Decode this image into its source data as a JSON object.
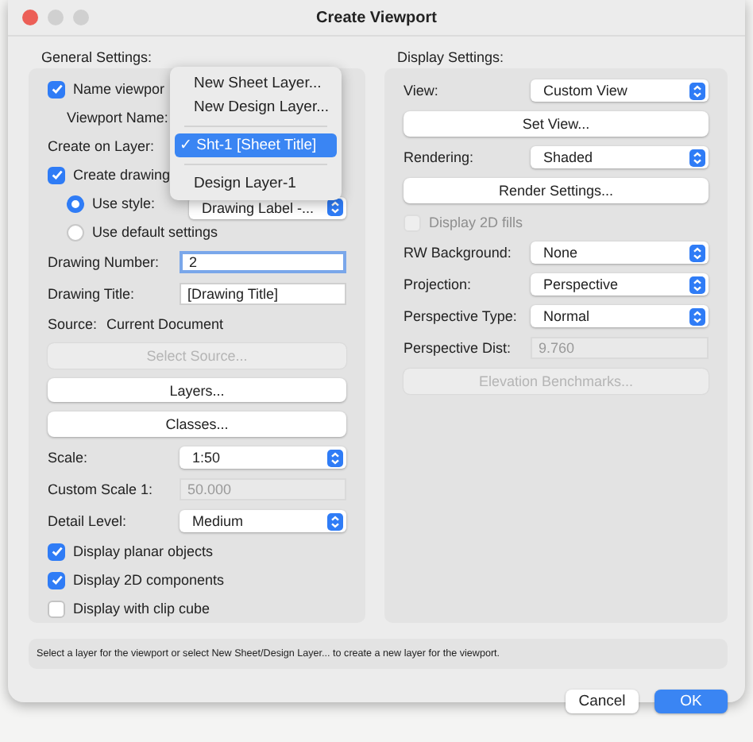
{
  "window": {
    "title": "Create Viewport"
  },
  "general": {
    "label": "General Settings:",
    "rows": [
      {
        "kind": "checkbox",
        "label": "Name viewpor",
        "checked": true,
        "disabled": false,
        "children": [
          {
            "kind": "label",
            "label": "Viewport Name:"
          }
        ]
      },
      {
        "kind": "label",
        "label": "Create on Layer:"
      },
      {
        "kind": "checkbox",
        "label": "Create drawing",
        "checked": true,
        "disabled": false,
        "children": [
          {
            "kind": "radio",
            "label": "Use style:",
            "selected": true,
            "value": "Drawing Label -..."
          },
          {
            "kind": "radio",
            "label": "Use default settings",
            "selected": false
          }
        ]
      },
      {
        "kind": "field",
        "label": "Drawing Number:",
        "value": "2",
        "focused": true,
        "disabled": false
      },
      {
        "kind": "field",
        "label": "Drawing Title:",
        "value": "[Drawing Title]",
        "focused": false,
        "disabled": false
      },
      {
        "kind": "text",
        "label": "Source:",
        "value": "Current Document"
      },
      {
        "kind": "button",
        "label": "Select Source...",
        "disabled": true
      },
      {
        "kind": "button",
        "label": "Layers...",
        "disabled": false
      },
      {
        "kind": "button",
        "label": "Classes...",
        "disabled": false
      },
      {
        "kind": "popup",
        "label": "Scale:",
        "value": "1:50"
      },
      {
        "kind": "field",
        "label": "Custom Scale 1:",
        "value": "50.000",
        "focused": false,
        "disabled": true
      },
      {
        "kind": "popup",
        "label": "Detail Level:",
        "value": "Medium"
      },
      {
        "kind": "checkbox",
        "label": "Display planar objects",
        "checked": true,
        "disabled": false
      },
      {
        "kind": "checkbox",
        "label": "Display 2D components",
        "checked": true,
        "disabled": false
      },
      {
        "kind": "checkbox",
        "label": "Display with clip cube",
        "checked": false,
        "disabled": false
      }
    ]
  },
  "display": {
    "label": "Display Settings:",
    "rows": [
      {
        "kind": "popup",
        "label": "View:",
        "value": "Custom View"
      },
      {
        "kind": "button",
        "label": "Set View...",
        "disabled": false
      },
      {
        "kind": "popup",
        "label": "Rendering:",
        "value": "Shaded"
      },
      {
        "kind": "button",
        "label": "Render Settings...",
        "disabled": false
      },
      {
        "kind": "checkbox",
        "label": "Display 2D fills",
        "checked": false,
        "disabled": true
      },
      {
        "kind": "popup",
        "label": "RW Background:",
        "value": "None"
      },
      {
        "kind": "popup",
        "label": "Projection:",
        "value": "Perspective"
      },
      {
        "kind": "popup",
        "label": "Perspective Type:",
        "value": "Normal"
      },
      {
        "kind": "field",
        "label": "Perspective Dist:",
        "value": "9.760",
        "focused": false,
        "disabled": true
      },
      {
        "kind": "button",
        "label": "Elevation Benchmarks...",
        "disabled": true
      }
    ]
  },
  "menu": {
    "groups": [
      {
        "items": [
          {
            "label": "New Sheet Layer...",
            "selected": false
          },
          {
            "label": "New Design Layer...",
            "selected": false
          }
        ]
      },
      {
        "items": [
          {
            "label": "✓ Sht-1 [Sheet Title]",
            "selected": true
          }
        ]
      },
      {
        "items": [
          {
            "label": "Design Layer-1",
            "selected": false
          }
        ]
      }
    ]
  },
  "help": "Select a layer for the viewport or select New Sheet/Design Layer... to create a new layer for the viewport.",
  "buttons": [
    {
      "label": "Cancel",
      "default": false
    },
    {
      "label": "OK",
      "default": true
    }
  ]
}
